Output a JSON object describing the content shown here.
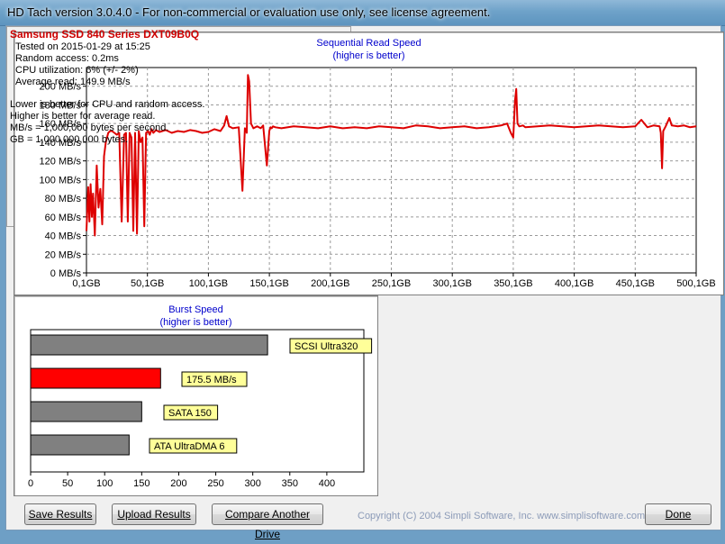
{
  "window": {
    "title": "HD Tach version 3.0.4.0  - For non-commercial or evaluation use only, see license agreement."
  },
  "sequential": {
    "title": "Sequential Read Speed",
    "subtitle": "(higher is better)"
  },
  "burst": {
    "title": "Burst Speed",
    "subtitle": "(higher is better)"
  },
  "info": {
    "drive": "Samsung SSD 840 Series DXT09B0Q",
    "tested_on": "Tested on 2015-01-29 at 15:25",
    "random_access": "Random access: 0.2ms",
    "cpu_utilization": "CPU utilization: 6% (+/- 2%)",
    "average_read": "Average read: 149.9 MB/s",
    "note1": "Lower is better for CPU and random access.",
    "note2": "Higher is better for average read.",
    "note3": "MB/s = 1,000,000 bytes per second.",
    "note4": "GB = 1,000,000,000 bytes."
  },
  "buttons": {
    "save": "Save Results",
    "upload": "Upload Results",
    "compare": "Compare Another Drive",
    "done": "Done"
  },
  "copyright": "Copyright (C) 2004 Simpli Software, Inc. www.simplisoftware.com",
  "colors": {
    "trace": "#dd0000",
    "bar_gray": "#808080",
    "bar_red": "#ff0000",
    "label_bg": "#ffff99",
    "title_blue": "#0000cc"
  },
  "chart_data": [
    {
      "type": "line",
      "title": "Sequential Read Speed",
      "subtitle": "(higher is better)",
      "xlim": [
        0.1,
        500
      ],
      "ylim": [
        0,
        220
      ],
      "x_ticks": [
        "0,1GB",
        "50,1GB",
        "100,1GB",
        "150,1GB",
        "200,1GB",
        "250,1GB",
        "300,1GB",
        "350,1GB",
        "400,1GB",
        "450,1GB",
        "500,1GB"
      ],
      "y_ticks": [
        "0 MB/s",
        "20 MB/s",
        "40 MB/s",
        "60 MB/s",
        "80 MB/s",
        "100 MB/s",
        "120 MB/s",
        "140 MB/s",
        "160 MB/s",
        "180 MB/s",
        "200 MB/s"
      ],
      "grid": true,
      "series": [
        {
          "x": [
            0.1,
            1.5,
            2.5,
            3.5,
            4.5,
            5.5,
            7,
            8.5,
            10,
            11.5,
            13,
            14.5,
            16,
            18,
            19.5,
            21,
            23,
            25,
            27,
            29,
            31,
            32.5,
            34,
            35.5,
            37,
            38.5,
            40,
            41.5,
            43,
            44.5,
            46,
            47.5,
            49,
            50.5,
            52,
            53.5,
            55,
            57,
            60,
            65,
            70,
            75,
            80,
            85,
            90,
            95,
            100,
            105,
            110,
            113,
            115,
            117,
            120,
            125,
            128,
            130,
            131.5,
            132.5,
            133.5,
            135,
            137,
            140,
            143,
            145,
            148,
            150,
            151,
            152,
            153,
            155,
            160,
            170,
            180,
            190,
            200,
            210,
            220,
            230,
            240,
            250,
            260,
            270,
            280,
            290,
            300,
            310,
            320,
            330,
            340,
            345,
            348,
            350,
            351.5,
            352.5,
            353.5,
            355,
            358,
            360,
            370,
            380,
            390,
            400,
            410,
            420,
            430,
            440,
            450,
            455,
            460,
            465,
            470,
            471,
            472,
            473,
            475,
            478,
            480,
            485,
            490,
            495,
            500
          ],
          "y": [
            45,
            92,
            55,
            95,
            60,
            85,
            40,
            115,
            70,
            90,
            52,
            125,
            140,
            150,
            152,
            152,
            150,
            148,
            150,
            55,
            148,
            150,
            55,
            150,
            145,
            45,
            150,
            42,
            152,
            140,
            145,
            50,
            150,
            152,
            148,
            154,
            150,
            153,
            151,
            153,
            150,
            152,
            151,
            153,
            152,
            150,
            151,
            154,
            152,
            158,
            168,
            157,
            155,
            156,
            88,
            155,
            150,
            212,
            205,
            160,
            155,
            157,
            155,
            158,
            115,
            152,
            156,
            155,
            157,
            156,
            155,
            157,
            156,
            155,
            157,
            155,
            156,
            155,
            157,
            156,
            155,
            158,
            157,
            155,
            156,
            157,
            155,
            156,
            158,
            160,
            150,
            145,
            185,
            197,
            160,
            157,
            158,
            156,
            157,
            158,
            157,
            156,
            157,
            158,
            157,
            156,
            157,
            164,
            156,
            158,
            157,
            150,
            112,
            152,
            157,
            166,
            158,
            157,
            158,
            156,
            157
          ]
        }
      ]
    },
    {
      "type": "bar",
      "orientation": "horizontal",
      "title": "Burst Speed",
      "subtitle": "(higher is better)",
      "xlim": [
        0,
        450
      ],
      "x_ticks": [
        0,
        50,
        100,
        150,
        200,
        250,
        300,
        350,
        400
      ],
      "categories": [
        "SCSI Ultra320",
        "175.5 MB/s",
        "SATA 150",
        "ATA UltraDMA 6"
      ],
      "values": [
        320,
        175.5,
        150,
        133
      ],
      "highlight_index": 1
    }
  ]
}
